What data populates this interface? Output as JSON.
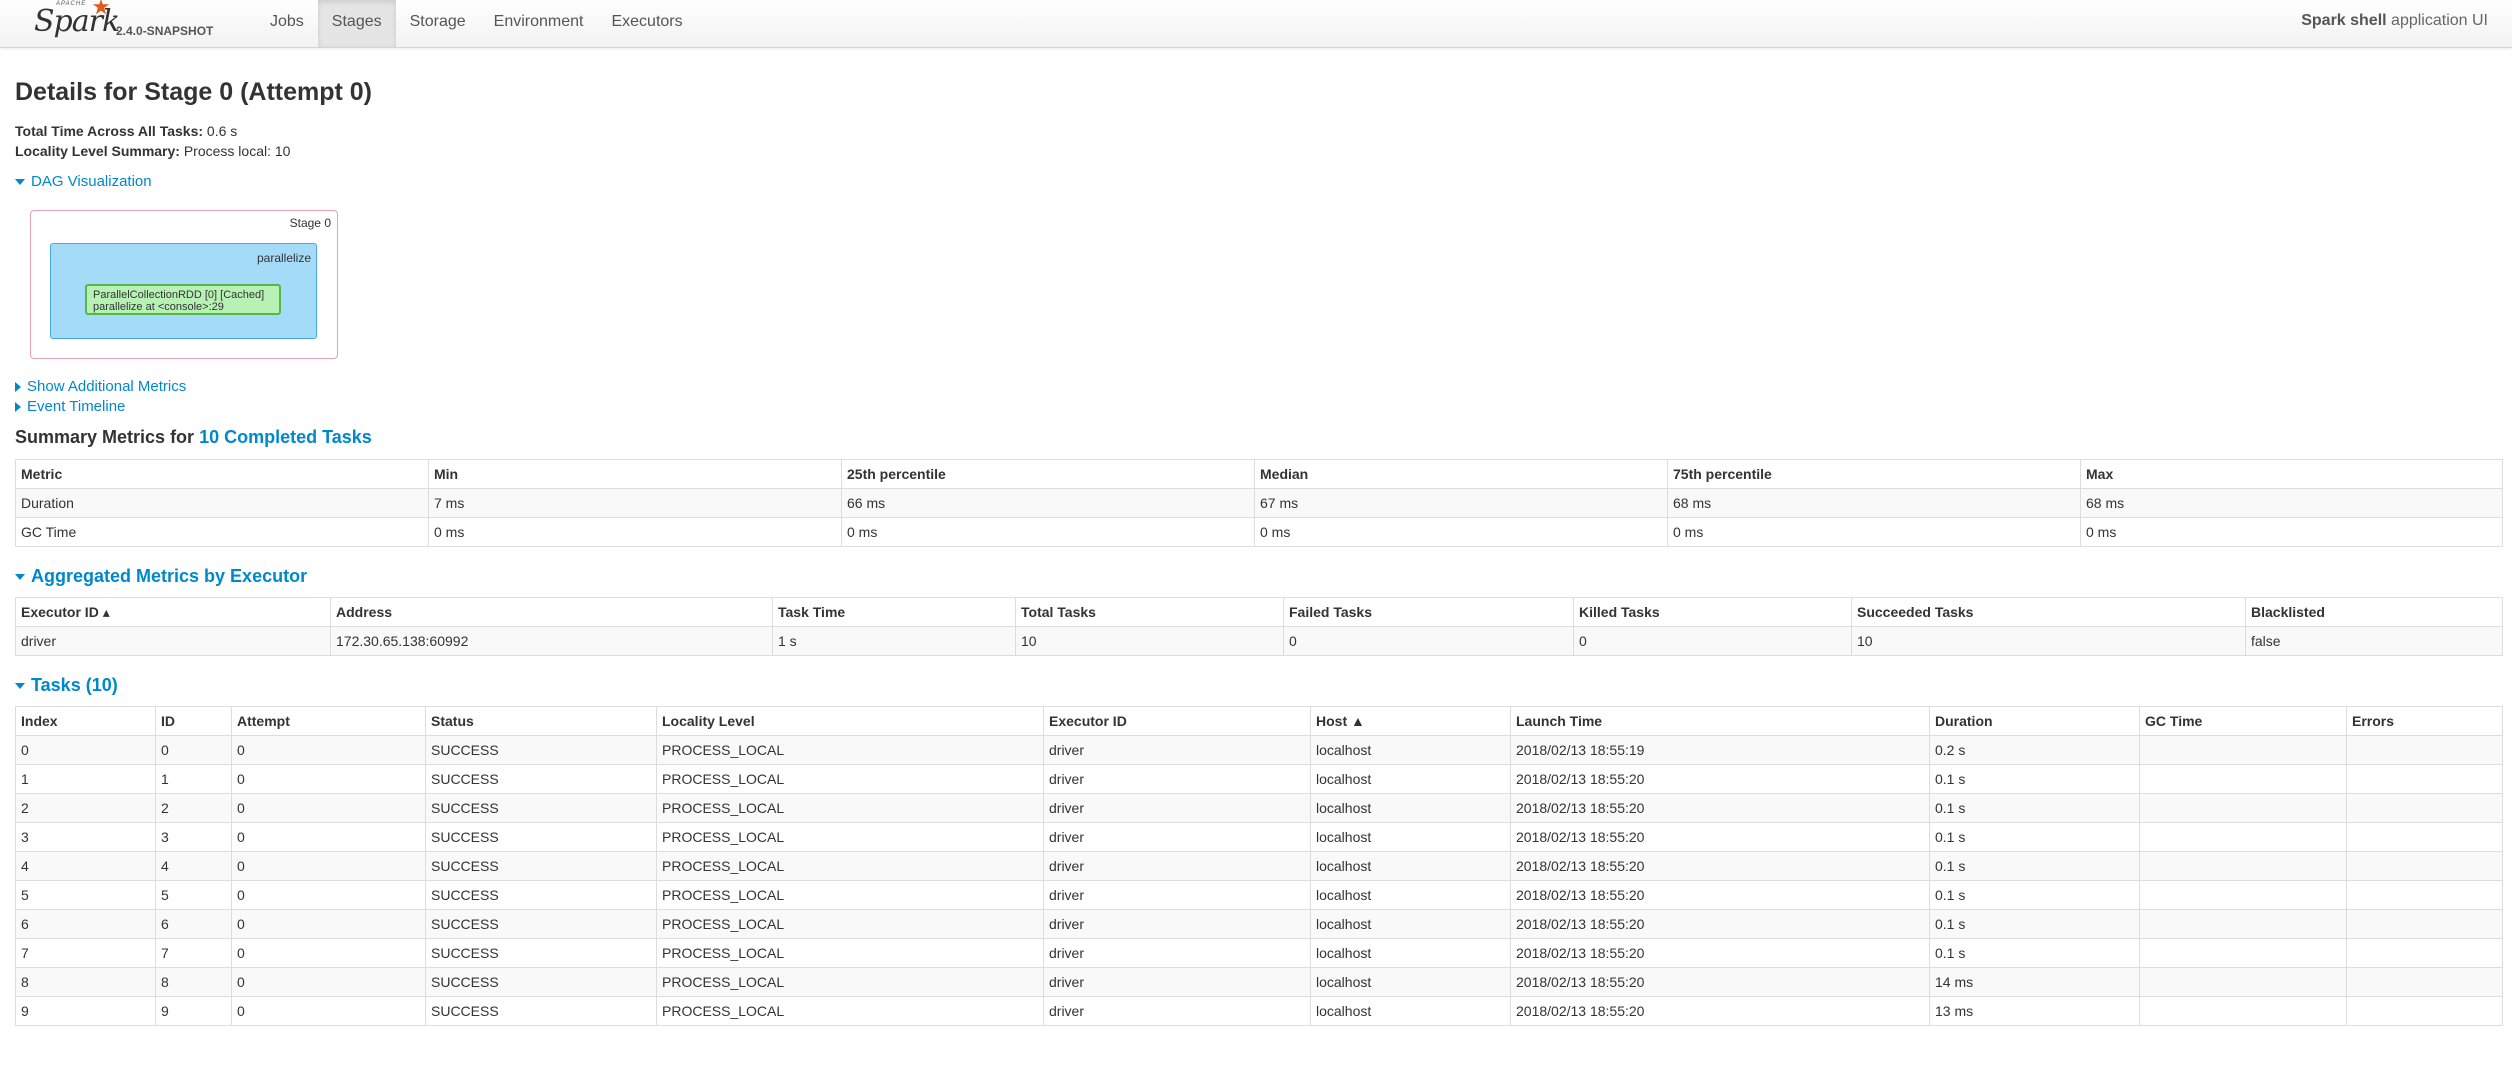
{
  "navbar": {
    "brand_small": "APACHE",
    "brand": "Spark",
    "version": "2.4.0-SNAPSHOT",
    "tabs": [
      "Jobs",
      "Stages",
      "Storage",
      "Environment",
      "Executors"
    ],
    "active_tab": "Stages",
    "app_name": "Spark shell",
    "app_suffix": "application UI"
  },
  "page": {
    "title": "Details for Stage 0 (Attempt 0)",
    "total_time_label": "Total Time Across All Tasks:",
    "total_time_value": "0.6 s",
    "locality_label": "Locality Level Summary:",
    "locality_value": "Process local: 10",
    "dag_toggle": "DAG Visualization",
    "show_metrics": "Show Additional Metrics",
    "event_timeline": "Event Timeline"
  },
  "dag": {
    "stage_label": "Stage 0",
    "cluster_label": "parallelize",
    "node_line1": "ParallelCollectionRDD [0] [Cached]",
    "node_line2": "parallelize at <console>:29"
  },
  "summary": {
    "title_prefix": "Summary Metrics for",
    "title_link": "10 Completed Tasks",
    "headers": [
      "Metric",
      "Min",
      "25th percentile",
      "Median",
      "75th percentile",
      "Max"
    ],
    "rows": [
      [
        "Duration",
        "7 ms",
        "66 ms",
        "67 ms",
        "68 ms",
        "68 ms"
      ],
      [
        "GC Time",
        "0 ms",
        "0 ms",
        "0 ms",
        "0 ms",
        "0 ms"
      ]
    ]
  },
  "executors": {
    "title": "Aggregated Metrics by Executor",
    "headers": [
      "Executor ID ▴",
      "Address",
      "Task Time",
      "Total Tasks",
      "Failed Tasks",
      "Killed Tasks",
      "Succeeded Tasks",
      "Blacklisted"
    ],
    "rows": [
      [
        "driver",
        "172.30.65.138:60992",
        "1 s",
        "10",
        "0",
        "0",
        "10",
        "false"
      ]
    ]
  },
  "tasks": {
    "title": "Tasks (10)",
    "headers": [
      "Index",
      "ID",
      "Attempt",
      "Status",
      "Locality Level",
      "Executor ID",
      "Host ▲",
      "Launch Time",
      "Duration",
      "GC Time",
      "Errors"
    ],
    "rows": [
      [
        "0",
        "0",
        "0",
        "SUCCESS",
        "PROCESS_LOCAL",
        "driver",
        "localhost",
        "2018/02/13 18:55:19",
        "0.2 s",
        "",
        ""
      ],
      [
        "1",
        "1",
        "0",
        "SUCCESS",
        "PROCESS_LOCAL",
        "driver",
        "localhost",
        "2018/02/13 18:55:20",
        "0.1 s",
        "",
        ""
      ],
      [
        "2",
        "2",
        "0",
        "SUCCESS",
        "PROCESS_LOCAL",
        "driver",
        "localhost",
        "2018/02/13 18:55:20",
        "0.1 s",
        "",
        ""
      ],
      [
        "3",
        "3",
        "0",
        "SUCCESS",
        "PROCESS_LOCAL",
        "driver",
        "localhost",
        "2018/02/13 18:55:20",
        "0.1 s",
        "",
        ""
      ],
      [
        "4",
        "4",
        "0",
        "SUCCESS",
        "PROCESS_LOCAL",
        "driver",
        "localhost",
        "2018/02/13 18:55:20",
        "0.1 s",
        "",
        ""
      ],
      [
        "5",
        "5",
        "0",
        "SUCCESS",
        "PROCESS_LOCAL",
        "driver",
        "localhost",
        "2018/02/13 18:55:20",
        "0.1 s",
        "",
        ""
      ],
      [
        "6",
        "6",
        "0",
        "SUCCESS",
        "PROCESS_LOCAL",
        "driver",
        "localhost",
        "2018/02/13 18:55:20",
        "0.1 s",
        "",
        ""
      ],
      [
        "7",
        "7",
        "0",
        "SUCCESS",
        "PROCESS_LOCAL",
        "driver",
        "localhost",
        "2018/02/13 18:55:20",
        "0.1 s",
        "",
        ""
      ],
      [
        "8",
        "8",
        "0",
        "SUCCESS",
        "PROCESS_LOCAL",
        "driver",
        "localhost",
        "2018/02/13 18:55:20",
        "14 ms",
        "",
        ""
      ],
      [
        "9",
        "9",
        "0",
        "SUCCESS",
        "PROCESS_LOCAL",
        "driver",
        "localhost",
        "2018/02/13 18:55:20",
        "13 ms",
        "",
        ""
      ]
    ]
  }
}
